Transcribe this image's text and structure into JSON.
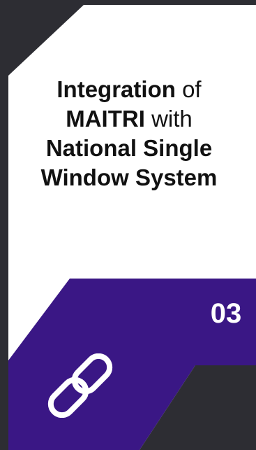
{
  "card": {
    "title": {
      "line1_bold": "Integration",
      "line1_normal": "of",
      "line2_bold": "MAITRI",
      "line2_normal": "with",
      "line3_bold": "National Single",
      "line4_bold": "Window System"
    },
    "number": "03",
    "icon": "link-icon"
  },
  "colors": {
    "background": "#2d2d33",
    "card": "#ffffff",
    "accent": "#3a1785",
    "text": "#111111",
    "number": "#ffffff"
  }
}
